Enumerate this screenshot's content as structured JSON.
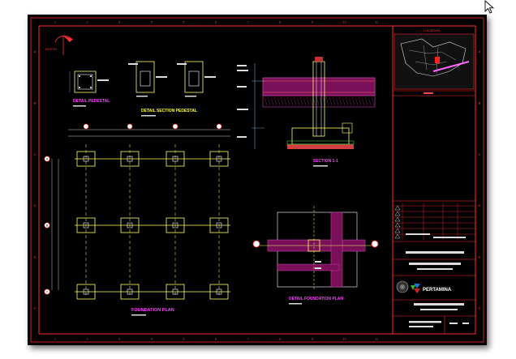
{
  "app": {
    "title": ""
  },
  "sheet": {
    "grid_columns": [
      "1",
      "2",
      "3",
      "4",
      "5",
      "6",
      "7",
      "8",
      "9",
      "10",
      "11"
    ],
    "grid_rows": [
      "A",
      "B",
      "C",
      "D",
      "E",
      "F"
    ],
    "drawings": {
      "detail_label": "DETAIL PEDESTAL",
      "section_label": "DETAIL SECTION PEDESTAL",
      "section_title": "SECTION 1-1",
      "plan_title": "FOUNDATION PLAN",
      "detail_plan_title": "DETAIL FOUNDATION PLAN",
      "grid_bubbles": [
        "A",
        "B",
        "C"
      ]
    },
    "titleblock": {
      "location_label": "LOCATION",
      "logo_text": "PERTAMINA"
    }
  },
  "colors": {
    "frame": "#ff2a2a",
    "drawing": "#ffff66",
    "title_magenta": "#ff44ff",
    "title_yellow": "#ffff33",
    "rebar_magenta": "#c040a0",
    "text_white": "#ffffff"
  },
  "icons": {
    "cursor": "arrow-cursor-icon",
    "logo": "pertamina-logo-icon",
    "north": "north-arrow-icon"
  }
}
